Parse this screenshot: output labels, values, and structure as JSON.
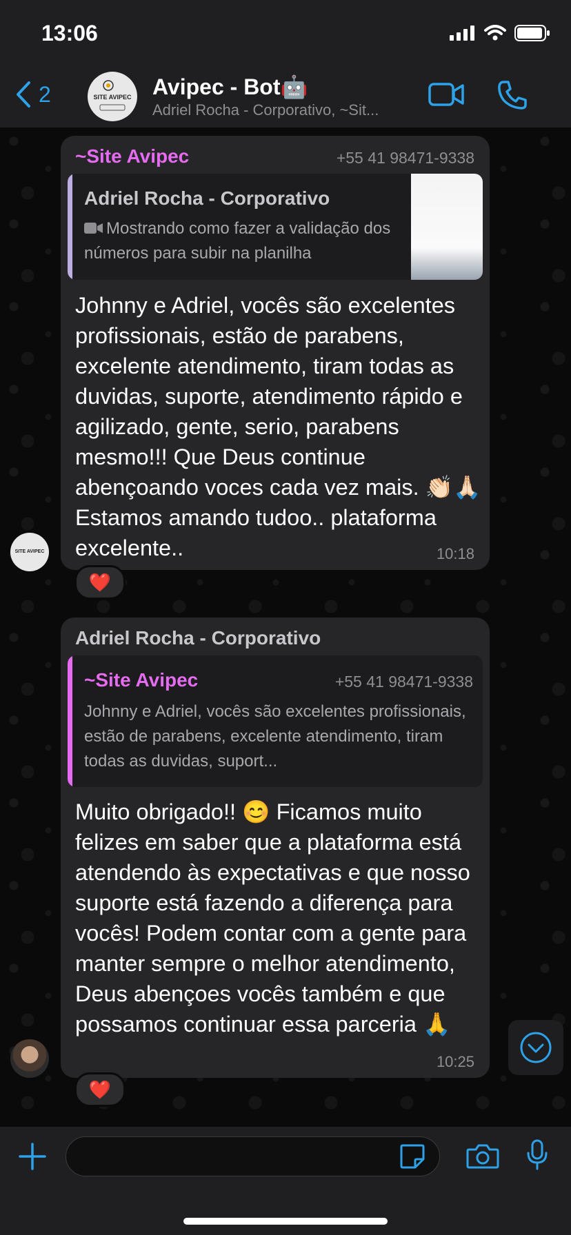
{
  "status_bar": {
    "time": "13:06"
  },
  "header": {
    "back_count": "2",
    "title": "Avipec - Bot🤖",
    "subtitle": "Adriel Rocha - Corporativo, ~Sit...",
    "avatar_label": "SITE AVIPEC",
    "avatar_brand": "Avipec"
  },
  "colors": {
    "accent": "#2da2e8",
    "sender_pink": "#e56bf0",
    "sender_gray": "#c7c7cc",
    "bubble": "#262628",
    "reaction": "#ff3b30"
  },
  "messages": [
    {
      "sender": "~Site Avipec",
      "phone": "+55 41 98471-9338",
      "quote": {
        "sender": "Adriel Rocha - Corporativo",
        "text": "Mostrando como fazer a validação dos números para subir na planilha",
        "media_icon": "video-icon"
      },
      "text": "Johnny e Adriel, vocês são excelentes profissionais, estão de parabens, excelente atendimento, tiram todas as duvidas, suporte, atendimento rápido e agilizado, gente, serio, parabens mesmo!!! Que Deus continue abençoando voces cada vez mais. 👏🏻🙏🏻 Estamos amando tudoo.. plataforma excelente..",
      "time": "10:18",
      "reaction": "❤️"
    },
    {
      "sender": "Adriel Rocha - Corporativo",
      "quote": {
        "sender": "~Site Avipec",
        "phone": "+55 41 98471-9338",
        "text": "Johnny e Adriel, vocês são excelentes profissionais, estão de parabens, excelente atendimento, tiram todas as duvidas, suport..."
      },
      "text": "Muito obrigado!! 😊 Ficamos muito felizes em saber que a plataforma está atendendo às expectativas e que nosso suporte está fazendo a diferença para vocês! Podem contar com a gente para manter sempre o melhor atendimento, Deus abençoes vocês também e que possamos continuar essa parceria 🙏",
      "time": "10:25",
      "reaction": "❤️"
    }
  ],
  "composer": {
    "placeholder": ""
  }
}
